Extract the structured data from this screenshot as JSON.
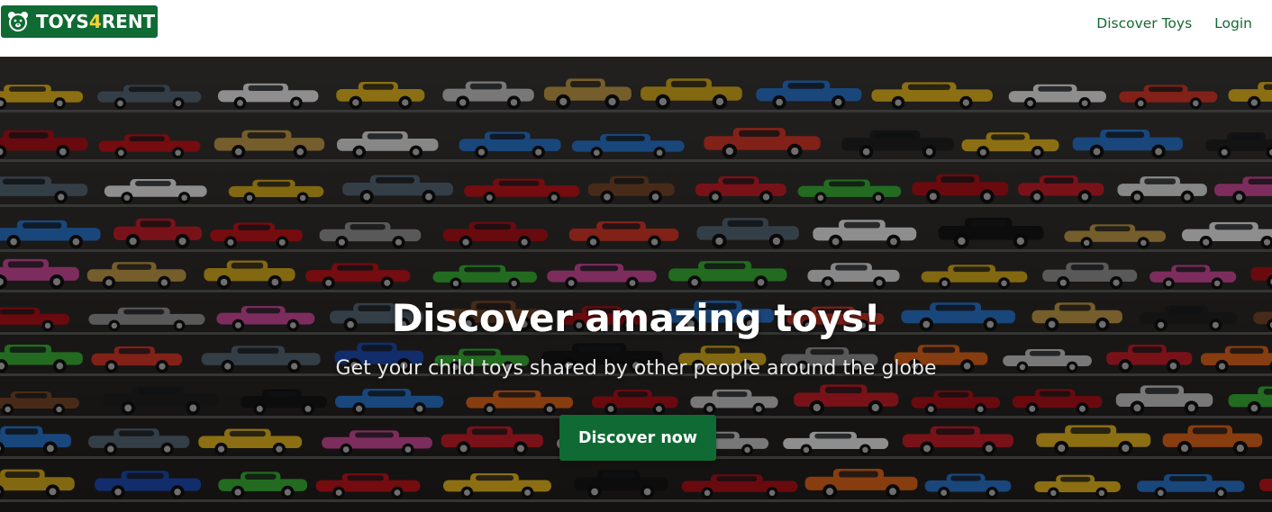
{
  "brand": {
    "name_part1": "TOYS",
    "name_part2": "4",
    "name_part3": "RENT",
    "logo_icon": "bear-face-icon",
    "color": "#0f6b33"
  },
  "nav": {
    "items": [
      {
        "label": "Discover Toys"
      },
      {
        "label": "Login"
      }
    ],
    "link_color": "#14692f"
  },
  "hero": {
    "background": "shelves-of-toy-cars-photo",
    "title": "Discover amazing toys!",
    "subtitle": "Get your child toys shared by other people around the globe",
    "cta_label": "Discover now",
    "cta_color": "#0f6b33"
  }
}
